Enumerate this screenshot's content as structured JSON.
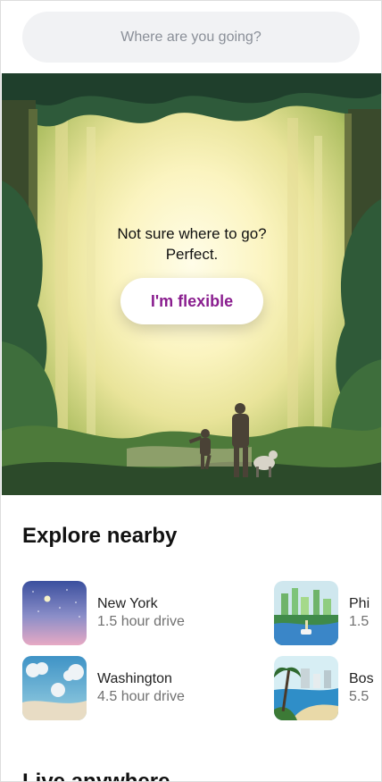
{
  "search": {
    "placeholder": "Where are you going?"
  },
  "hero": {
    "line1": "Not sure where to go?",
    "line2": "Perfect.",
    "button_label": "I'm flexible"
  },
  "explore": {
    "title": "Explore nearby",
    "places": [
      {
        "name": "New York",
        "drive": "1.5 hour drive"
      },
      {
        "name": "Phi",
        "drive": "1.5"
      },
      {
        "name": "Washington",
        "drive": "4.5 hour drive"
      },
      {
        "name": "Bos",
        "drive": "5.5"
      }
    ]
  },
  "live": {
    "title": "Live anywhere"
  },
  "colors": {
    "accent": "#8a1e8f",
    "search_bg": "#f1f2f4",
    "muted": "#717171"
  }
}
